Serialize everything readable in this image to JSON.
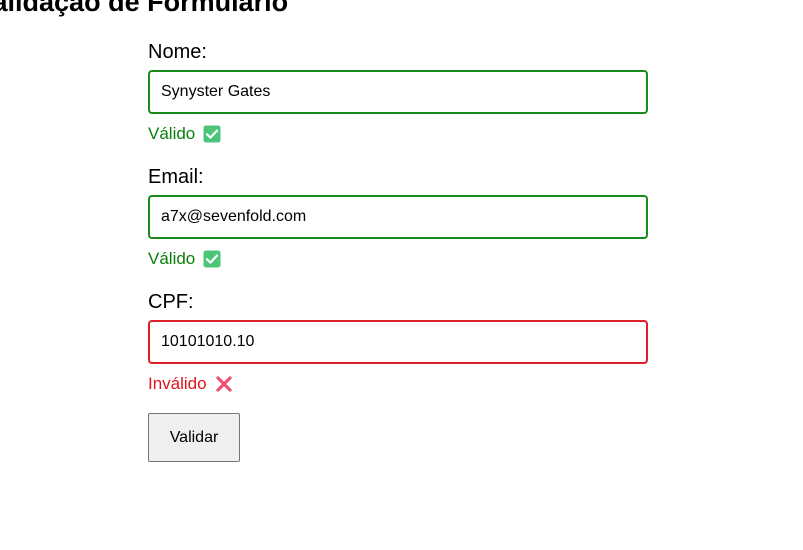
{
  "page": {
    "title": "Validação de Formulário"
  },
  "form": {
    "fields": [
      {
        "label": "Nome:",
        "value": "Synyster Gates",
        "status": "valid",
        "status_text": "Válido",
        "status_icon": "check-mark-icon"
      },
      {
        "label": "Email:",
        "value": "a7x@sevenfold.com",
        "status": "valid",
        "status_text": "Válido",
        "status_icon": "check-mark-icon"
      },
      {
        "label": "CPF:",
        "value": "10101010.10",
        "status": "invalid",
        "status_text": "Inválido",
        "status_icon": "cross-mark-icon"
      }
    ],
    "submit_label": "Validar"
  },
  "colors": {
    "valid_border": "#1a8a1a",
    "valid_text": "#0b7d0b",
    "invalid_border": "#dd1f2a",
    "invalid_text": "#e0131f",
    "check_icon_bg": "#4cc47a",
    "cross_icon": "#f0506e"
  }
}
